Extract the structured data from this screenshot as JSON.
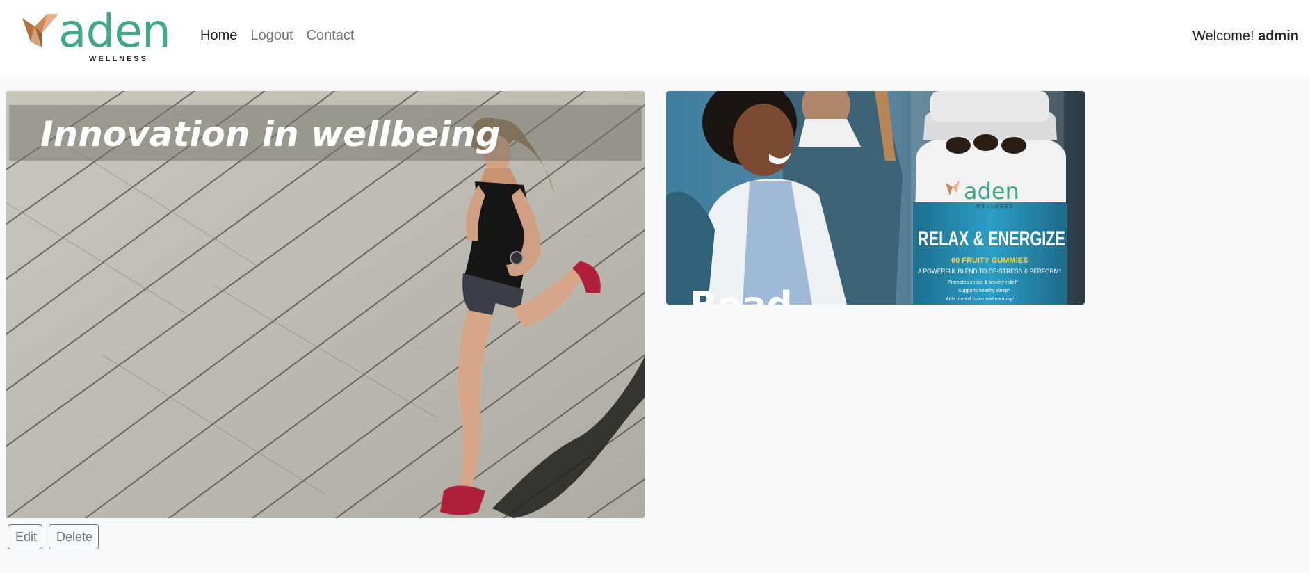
{
  "brand": {
    "name": "aden",
    "subtitle": "WELLNESS",
    "accent": "#3fa886",
    "bird_color": "#c8875a"
  },
  "nav": {
    "items": [
      {
        "label": "Home",
        "active": true
      },
      {
        "label": "Logout",
        "active": false
      },
      {
        "label": "Contact",
        "active": false
      }
    ]
  },
  "user": {
    "welcome": "Welcome!",
    "name": "admin"
  },
  "hero": {
    "title": "Innovation in wellbeing"
  },
  "side_card": {
    "partial_title": "Read",
    "product": {
      "brand": "aden",
      "brand_sub": "WELLNESS",
      "name": "RELAX & ENERGIZE",
      "count": "60 FRUITY GUMMIES",
      "tagline": "A POWERFUL BLEND TO DE-STRESS & PERFORM*",
      "benefits": [
        "Promotes stress & anxiety relief*",
        "Supports healthy sleep*",
        "Aids mental focus and memory*"
      ]
    }
  },
  "actions": {
    "edit_label": "Edit",
    "delete_label": "Delete"
  }
}
